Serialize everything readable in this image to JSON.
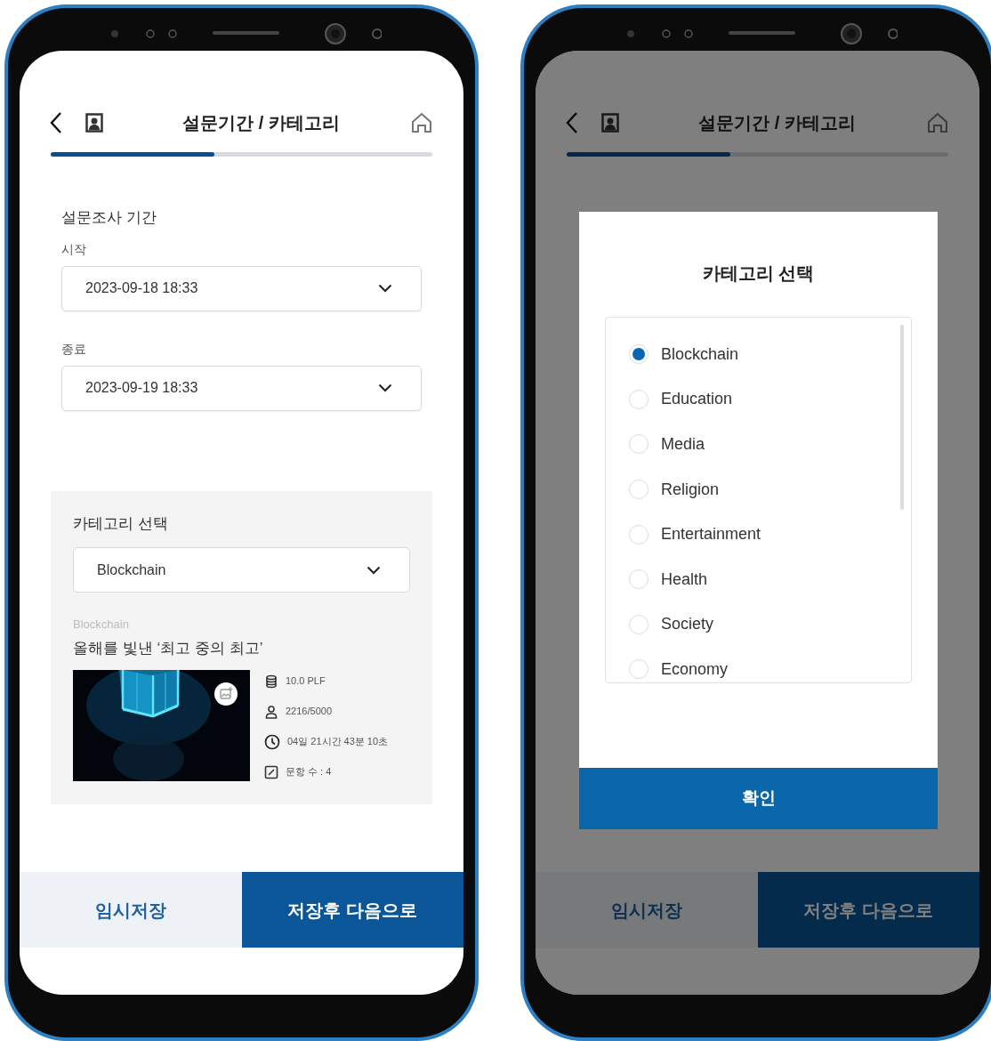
{
  "phones": [
    {
      "header": {
        "title": "설문기간 / 카테고리"
      },
      "progress": {
        "level": 0.43
      },
      "period": {
        "title": "설문조사 기간",
        "fields": [
          {
            "label": "시작",
            "value": "2023-09-18 18:33"
          },
          {
            "label": "종료",
            "value": "2023-09-19 18:33"
          }
        ]
      },
      "category": {
        "title": "카테고리 선택",
        "value": "Blockchain",
        "card": {
          "category": "Blockchain",
          "title": "올해를 빛낸 ‘최고 중의 최고’",
          "stats": [
            {
              "kind": "coins",
              "text": "10.0 PLF"
            },
            {
              "kind": "person",
              "text": "2216/5000"
            },
            {
              "kind": "clock",
              "text": "04일 21시간 43분 10초"
            },
            {
              "kind": "edit",
              "text": "문항 수 : 4"
            }
          ]
        }
      },
      "footer": [
        {
          "kind": "secondary",
          "label": "임시저장"
        },
        {
          "kind": "primary",
          "label": "저장후 다음으로"
        }
      ]
    },
    {
      "header": {
        "title": "설문기간 / 카테고리"
      },
      "progress": {
        "level": 0.43
      },
      "footer": [
        {
          "kind": "secondary",
          "label": "임시저장"
        },
        {
          "kind": "primary",
          "label": "저장후 다음으로"
        }
      ],
      "dialog": {
        "title": "카테고리 선택",
        "options": [
          {
            "label": "Blockchain",
            "selected": true
          },
          {
            "label": "Education",
            "selected": false
          },
          {
            "label": "Media",
            "selected": false
          },
          {
            "label": "Religion",
            "selected": false
          },
          {
            "label": "Entertainment",
            "selected": false
          },
          {
            "label": "Health",
            "selected": false
          },
          {
            "label": "Society",
            "selected": false
          },
          {
            "label": "Economy",
            "selected": false
          }
        ],
        "confirm": "확인"
      }
    }
  ]
}
